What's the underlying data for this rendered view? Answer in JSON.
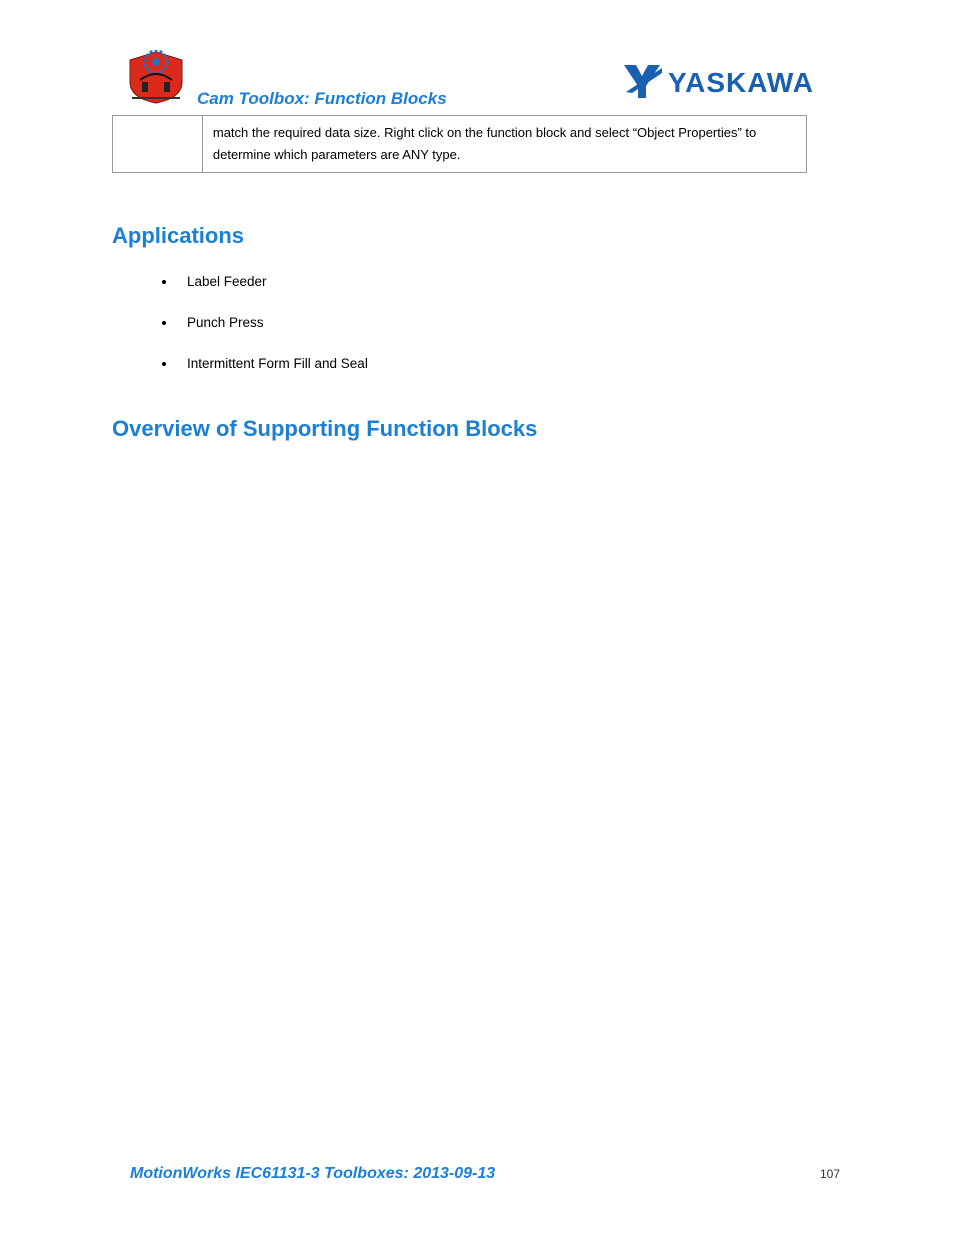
{
  "header": {
    "title": "Cam Toolbox: Function Blocks",
    "brand": "YASKAWA"
  },
  "table": {
    "cell": "match the required data size. Right click on the function block and select “Object Properties” to determine which parameters are ANY type."
  },
  "sections": {
    "applications_heading": "Applications",
    "applications": [
      "Label Feeder",
      "Punch Press",
      "Intermittent Form Fill and Seal"
    ],
    "overview_heading": "Overview of Supporting Function Blocks"
  },
  "footer": {
    "text": "MotionWorks IEC61131-3 Toolboxes: 2013-09-13",
    "page": "107"
  }
}
